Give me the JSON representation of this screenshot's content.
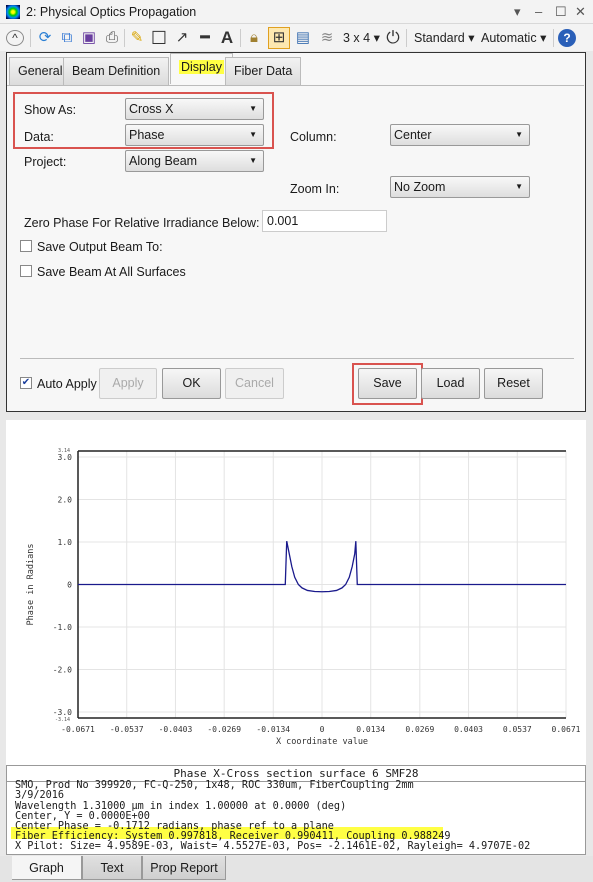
{
  "window": {
    "title": "2: Physical Optics Propagation"
  },
  "toolbar": {
    "layout": "3 x 4",
    "standard": "Standard",
    "automatic": "Automatic"
  },
  "tabs": [
    "General",
    "Beam Definition",
    "Display",
    "Fiber Data"
  ],
  "settings": {
    "show_as_label": "Show As:",
    "show_as_value": "Cross X",
    "data_label": "Data:",
    "data_value": "Phase",
    "project_label": "Project:",
    "project_value": "Along Beam",
    "column_label": "Column:",
    "column_value": "Center",
    "zoom_label": "Zoom In:",
    "zoom_value": "No Zoom",
    "zero_phase_label": "Zero Phase For Relative Irradiance Below:",
    "zero_phase_value": "0.001",
    "save_output_label": "Save Output Beam To:",
    "save_output_checked": false,
    "save_all_label": "Save Beam At All Surfaces",
    "save_all_checked": false,
    "auto_apply_label": "Auto Apply",
    "auto_apply_checked": true
  },
  "buttons": {
    "apply": "Apply",
    "ok": "OK",
    "cancel": "Cancel",
    "save": "Save",
    "load": "Load",
    "reset": "Reset"
  },
  "colors": {
    "highlight": "#ffff44",
    "callout": "#d9534f",
    "curve": "#1a1a8c"
  },
  "chart_data": {
    "type": "line",
    "xlabel": "X coordinate value",
    "ylabel": "Phase in Radians",
    "xlim": [
      -0.0671,
      0.0671
    ],
    "ylim": [
      -3.14,
      3.14
    ],
    "xticks": [
      "-0.0671",
      "-0.0537",
      "-0.0403",
      "-0.0269",
      "-0.0134",
      "0",
      "0.0134",
      "0.0269",
      "0.0403",
      "0.0537",
      "0.0671"
    ],
    "yticks": [
      "3.0",
      "2.0",
      "1.0",
      "0",
      "-1.0",
      "-2.0",
      "-3.0"
    ],
    "ylim_labels": [
      "3.14",
      "-3.14"
    ],
    "grid": true,
    "points": [
      [
        -0.0671,
        0
      ],
      [
        -0.0101,
        0
      ],
      [
        -0.0097,
        1.02
      ],
      [
        -0.009,
        0.72
      ],
      [
        -0.0083,
        0.42
      ],
      [
        -0.0075,
        0.17
      ],
      [
        -0.0065,
        0.0
      ],
      [
        -0.0055,
        -0.08
      ],
      [
        -0.004,
        -0.14
      ],
      [
        -0.002,
        -0.165
      ],
      [
        0,
        -0.171
      ],
      [
        0.002,
        -0.165
      ],
      [
        0.004,
        -0.14
      ],
      [
        0.0055,
        -0.08
      ],
      [
        0.0065,
        0.0
      ],
      [
        0.0075,
        0.17
      ],
      [
        0.0083,
        0.42
      ],
      [
        0.009,
        0.72
      ],
      [
        0.0093,
        1.02
      ],
      [
        0.0097,
        0
      ],
      [
        0.0671,
        0
      ]
    ]
  },
  "info": {
    "title": "Phase X-Cross section surface 6 SMF28",
    "lines": [
      "SMO, Prod No 399920, FC-Q-250, 1x48, ROC 330um, FiberCoupling 2mm",
      "3/9/2016",
      "Wavelength 1.31000 µm in index 1.00000 at 0.0000 (deg)",
      "Center, Y = 0.0000E+00",
      "Center Phase = -0.1712 radians, phase ref to a plane",
      "Fiber Efficiency: System 0.997818, Receiver 0.990411, Coupling 0.988249",
      "X Pilot: Size= 4.9589E-03, Waist= 4.5527E-03, Pos= -2.1461E-02, Rayleigh= 4.9707E-02"
    ]
  },
  "bottom_tabs": [
    "Graph",
    "Text",
    "Prop Report"
  ]
}
